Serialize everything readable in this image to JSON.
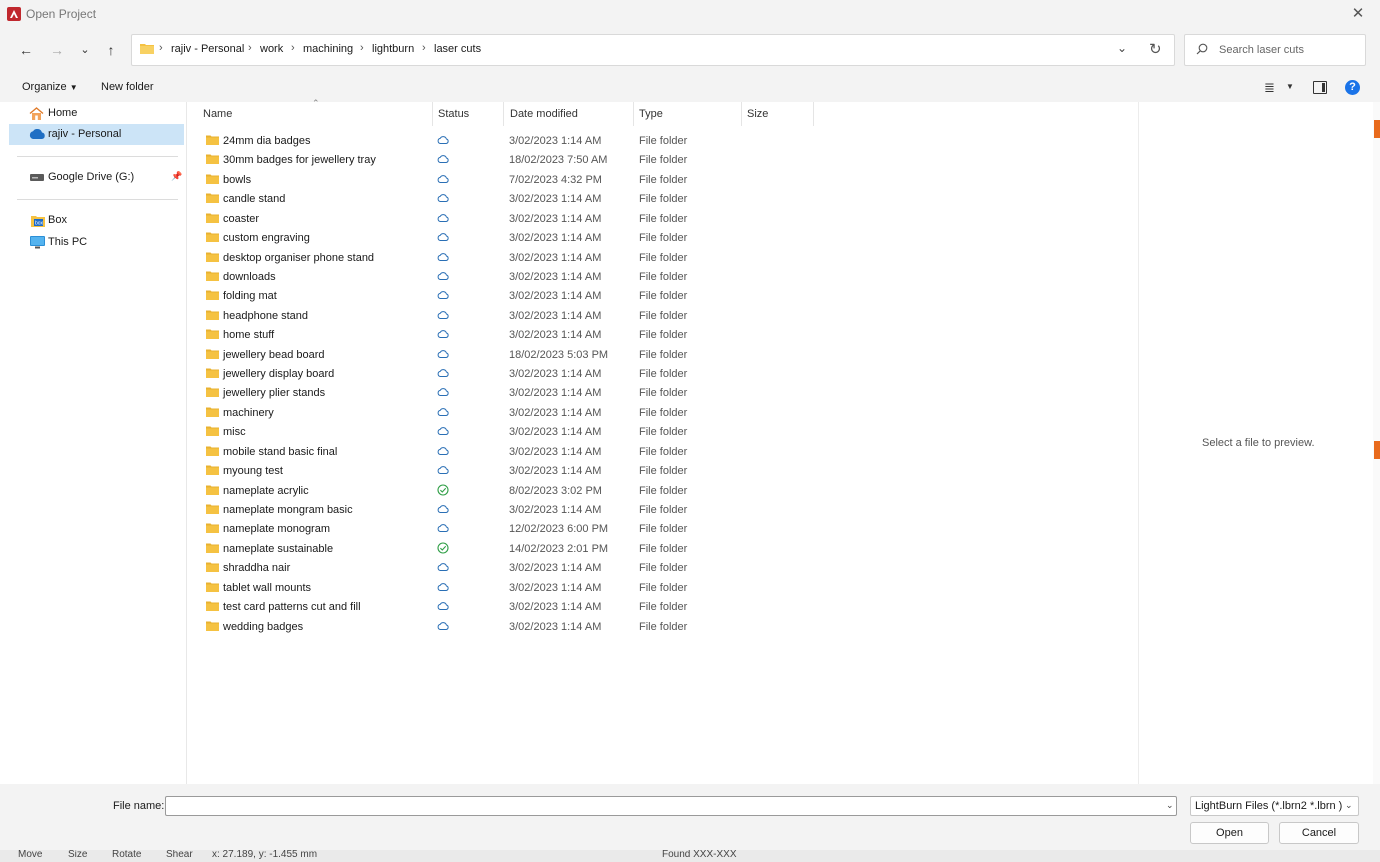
{
  "window": {
    "title": "Open Project"
  },
  "breadcrumb": [
    "rajiv - Personal",
    "work",
    "machining",
    "lightburn",
    "laser cuts"
  ],
  "search": {
    "placeholder": "Search laser cuts"
  },
  "toolbar": {
    "organize_label": "Organize",
    "new_folder_label": "New folder"
  },
  "sidebar": {
    "items": [
      {
        "label": "Home",
        "icon": "home-icon"
      },
      {
        "label": "rajiv - Personal",
        "icon": "onedrive-cloud-icon",
        "selected": true
      },
      {
        "label": "Google Drive (G:)",
        "icon": "drive-icon",
        "pinned": true
      },
      {
        "label": "Box",
        "icon": "box-icon"
      },
      {
        "label": "This PC",
        "icon": "pc-icon"
      }
    ]
  },
  "columns": {
    "name": "Name",
    "status": "Status",
    "date": "Date modified",
    "type": "Type",
    "size": "Size"
  },
  "files": [
    {
      "name": "24mm dia badges",
      "status": "cloud",
      "date": "3/02/2023 1:14 AM",
      "type": "File folder"
    },
    {
      "name": "30mm badges for jewellery tray",
      "status": "cloud",
      "date": "18/02/2023 7:50 AM",
      "type": "File folder"
    },
    {
      "name": "bowls",
      "status": "cloud",
      "date": "7/02/2023 4:32 PM",
      "type": "File folder"
    },
    {
      "name": "candle stand",
      "status": "cloud",
      "date": "3/02/2023 1:14 AM",
      "type": "File folder"
    },
    {
      "name": "coaster",
      "status": "cloud",
      "date": "3/02/2023 1:14 AM",
      "type": "File folder"
    },
    {
      "name": "custom engraving",
      "status": "cloud",
      "date": "3/02/2023 1:14 AM",
      "type": "File folder"
    },
    {
      "name": "desktop organiser phone stand",
      "status": "cloud",
      "date": "3/02/2023 1:14 AM",
      "type": "File folder"
    },
    {
      "name": "downloads",
      "status": "cloud",
      "date": "3/02/2023 1:14 AM",
      "type": "File folder"
    },
    {
      "name": "folding mat",
      "status": "cloud",
      "date": "3/02/2023 1:14 AM",
      "type": "File folder"
    },
    {
      "name": "headphone stand",
      "status": "cloud",
      "date": "3/02/2023 1:14 AM",
      "type": "File folder"
    },
    {
      "name": "home stuff",
      "status": "cloud",
      "date": "3/02/2023 1:14 AM",
      "type": "File folder"
    },
    {
      "name": "jewellery bead board",
      "status": "cloud",
      "date": "18/02/2023 5:03 PM",
      "type": "File folder"
    },
    {
      "name": "jewellery display board",
      "status": "cloud",
      "date": "3/02/2023 1:14 AM",
      "type": "File folder"
    },
    {
      "name": "jewellery plier stands",
      "status": "cloud",
      "date": "3/02/2023 1:14 AM",
      "type": "File folder"
    },
    {
      "name": "machinery",
      "status": "cloud",
      "date": "3/02/2023 1:14 AM",
      "type": "File folder"
    },
    {
      "name": "misc",
      "status": "cloud",
      "date": "3/02/2023 1:14 AM",
      "type": "File folder"
    },
    {
      "name": "mobile stand basic final",
      "status": "cloud",
      "date": "3/02/2023 1:14 AM",
      "type": "File folder"
    },
    {
      "name": "myoung test",
      "status": "cloud",
      "date": "3/02/2023 1:14 AM",
      "type": "File folder"
    },
    {
      "name": "nameplate acrylic",
      "status": "synced",
      "date": "8/02/2023 3:02 PM",
      "type": "File folder"
    },
    {
      "name": "nameplate mongram basic",
      "status": "cloud",
      "date": "3/02/2023 1:14 AM",
      "type": "File folder"
    },
    {
      "name": "nameplate monogram",
      "status": "cloud",
      "date": "12/02/2023 6:00 PM",
      "type": "File folder"
    },
    {
      "name": "nameplate sustainable",
      "status": "synced",
      "date": "14/02/2023 2:01 PM",
      "type": "File folder"
    },
    {
      "name": "shraddha nair",
      "status": "cloud",
      "date": "3/02/2023 1:14 AM",
      "type": "File folder"
    },
    {
      "name": "tablet wall mounts",
      "status": "cloud",
      "date": "3/02/2023 1:14 AM",
      "type": "File folder"
    },
    {
      "name": "test card patterns cut and fill",
      "status": "cloud",
      "date": "3/02/2023 1:14 AM",
      "type": "File folder"
    },
    {
      "name": "wedding badges",
      "status": "cloud",
      "date": "3/02/2023 1:14 AM",
      "type": "File folder"
    }
  ],
  "preview": {
    "text": "Select a file to preview."
  },
  "footer": {
    "filename_label": "File name:",
    "filename_value": "",
    "filter_value": "LightBurn Files (*.lbrn2 *.lbrn )",
    "open_label": "Open",
    "cancel_label": "Cancel"
  },
  "statusbar": {
    "items": [
      "Move",
      "Size",
      "Rotate",
      "Shear",
      "x: 27.189, y: -1.455 mm",
      "Found XXX-XXX"
    ]
  },
  "colors": {
    "accent": "#1a73e8",
    "folder": "#f5c242",
    "cloud": "#2a6fb5",
    "synced": "#2e9e45",
    "selected_bg": "#cce4f7"
  }
}
